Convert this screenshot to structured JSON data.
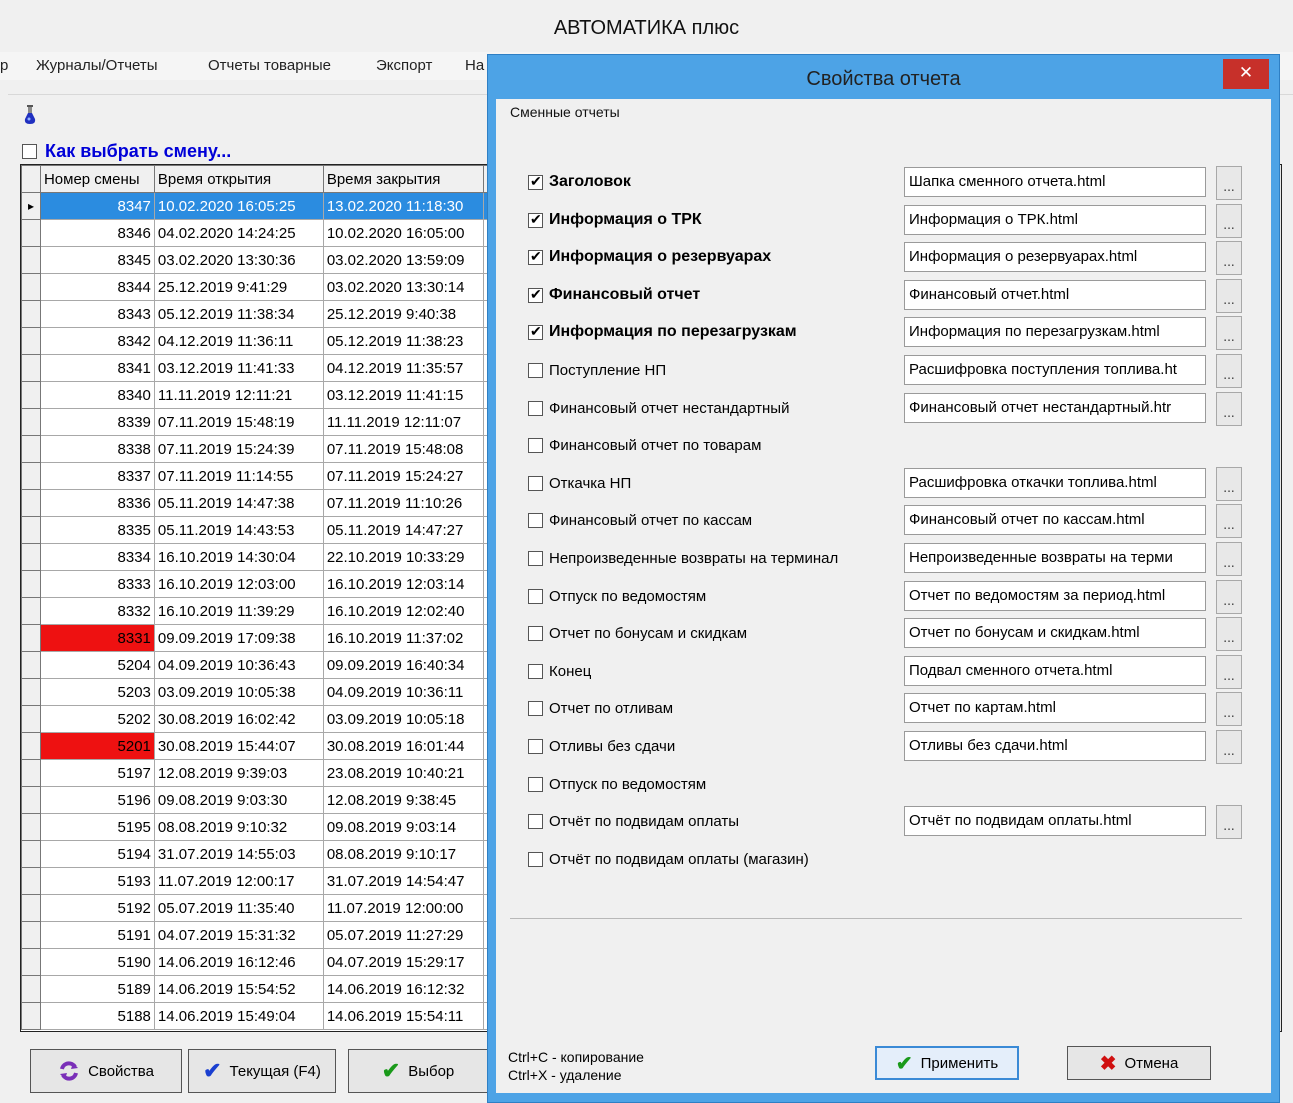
{
  "app": {
    "title": "АВТОМАТИКА плюс"
  },
  "menu": {
    "items": [
      {
        "label": "р"
      },
      {
        "label": "Журналы/Отчеты"
      },
      {
        "label": "Отчеты товарные"
      },
      {
        "label": "Экспорт"
      },
      {
        "label": "На"
      }
    ]
  },
  "shift_picker": {
    "link_label": "Как выбрать смену..."
  },
  "grid": {
    "columns": [
      "Номер смены",
      "Время открытия",
      "Время закрытия"
    ],
    "rows": [
      {
        "num": "8347",
        "open": "10.02.2020 16:05:25",
        "close": "13.02.2020 11:18:30"
      },
      {
        "num": "8346",
        "open": "04.02.2020 14:24:25",
        "close": "10.02.2020 16:05:00"
      },
      {
        "num": "8345",
        "open": "03.02.2020 13:30:36",
        "close": "03.02.2020 13:59:09"
      },
      {
        "num": "8344",
        "open": "25.12.2019 9:41:29",
        "close": "03.02.2020 13:30:14"
      },
      {
        "num": "8343",
        "open": "05.12.2019 11:38:34",
        "close": "25.12.2019 9:40:38"
      },
      {
        "num": "8342",
        "open": "04.12.2019 11:36:11",
        "close": "05.12.2019 11:38:23"
      },
      {
        "num": "8341",
        "open": "03.12.2019 11:41:33",
        "close": "04.12.2019 11:35:57"
      },
      {
        "num": "8340",
        "open": "11.11.2019 12:11:21",
        "close": "03.12.2019 11:41:15"
      },
      {
        "num": "8339",
        "open": "07.11.2019 15:48:19",
        "close": "11.11.2019 12:11:07"
      },
      {
        "num": "8338",
        "open": "07.11.2019 15:24:39",
        "close": "07.11.2019 15:48:08"
      },
      {
        "num": "8337",
        "open": "07.11.2019 11:14:55",
        "close": "07.11.2019 15:24:27"
      },
      {
        "num": "8336",
        "open": "05.11.2019 14:47:38",
        "close": "07.11.2019 11:10:26"
      },
      {
        "num": "8335",
        "open": "05.11.2019 14:43:53",
        "close": "05.11.2019 14:47:27"
      },
      {
        "num": "8334",
        "open": "16.10.2019 14:30:04",
        "close": "22.10.2019 10:33:29"
      },
      {
        "num": "8333",
        "open": "16.10.2019 12:03:00",
        "close": "16.10.2019 12:03:14"
      },
      {
        "num": "8332",
        "open": "16.10.2019 11:39:29",
        "close": "16.10.2019 12:02:40"
      },
      {
        "num": "8331",
        "open": "09.09.2019 17:09:38",
        "close": "16.10.2019 11:37:02"
      },
      {
        "num": "5204",
        "open": "04.09.2019 10:36:43",
        "close": "09.09.2019 16:40:34"
      },
      {
        "num": "5203",
        "open": "03.09.2019 10:05:38",
        "close": "04.09.2019 10:36:11"
      },
      {
        "num": "5202",
        "open": "30.08.2019 16:02:42",
        "close": "03.09.2019 10:05:18"
      },
      {
        "num": "5201",
        "open": "30.08.2019 15:44:07",
        "close": "30.08.2019 16:01:44"
      },
      {
        "num": "5197",
        "open": "12.08.2019 9:39:03",
        "close": "23.08.2019 10:40:21"
      },
      {
        "num": "5196",
        "open": "09.08.2019 9:03:30",
        "close": "12.08.2019 9:38:45"
      },
      {
        "num": "5195",
        "open": "08.08.2019 9:10:32",
        "close": "09.08.2019 9:03:14"
      },
      {
        "num": "5194",
        "open": "31.07.2019 14:55:03",
        "close": "08.08.2019 9:10:17"
      },
      {
        "num": "5193",
        "open": "11.07.2019 12:00:17",
        "close": "31.07.2019 14:54:47"
      },
      {
        "num": "5192",
        "open": "05.07.2019 11:35:40",
        "close": "11.07.2019 12:00:00"
      },
      {
        "num": "5191",
        "open": "04.07.2019 15:31:32",
        "close": "05.07.2019 11:27:29"
      },
      {
        "num": "5190",
        "open": "14.06.2019 16:12:46",
        "close": "04.07.2019 15:29:17"
      },
      {
        "num": "5189",
        "open": "14.06.2019 15:54:52",
        "close": "14.06.2019 16:12:32"
      },
      {
        "num": "5188",
        "open": "14.06.2019 15:49:04",
        "close": "14.06.2019 15:54:11"
      }
    ],
    "highlight_color": "#ee1111",
    "selection_color": "#2b8ce0"
  },
  "buttons": {
    "properties": "Свойства",
    "current": "Текущая (F4)",
    "select": "Выбор"
  },
  "dialog": {
    "title": "Свойства отчета",
    "close_icon": "close-icon",
    "group_title": "Сменные отчеты",
    "items": [
      {
        "label": "Заголовок",
        "checked": true,
        "bold": true,
        "file": "Шапка сменного отчета.html"
      },
      {
        "label": "Информация о ТРК",
        "checked": true,
        "bold": true,
        "file": "Информация о ТРК.html"
      },
      {
        "label": "Информация о резервуарах",
        "checked": true,
        "bold": true,
        "file": "Информация о резервуарах.html"
      },
      {
        "label": "Финансовый отчет",
        "checked": true,
        "bold": true,
        "file": "Финансовый отчет.html"
      },
      {
        "label": "Информация по перезагрузкам",
        "checked": true,
        "bold": true,
        "file": "Информация по перезагрузкам.html"
      },
      {
        "label": "Поступление НП",
        "checked": false,
        "bold": false,
        "file": "Расшифровка поступления топлива.ht"
      },
      {
        "label": "Финансовый отчет нестандартный",
        "checked": false,
        "bold": false,
        "file": "Финансовый отчет нестандартный.htr"
      },
      {
        "label": "Финансовый отчет по товарам",
        "checked": false,
        "bold": false,
        "file": null
      },
      {
        "label": "Откачка НП",
        "checked": false,
        "bold": false,
        "file": "Расшифровка откачки топлива.html"
      },
      {
        "label": "Финансовый отчет по кассам",
        "checked": false,
        "bold": false,
        "file": "Финансовый отчет по кассам.html"
      },
      {
        "label": "Непроизведенные возвраты на терминал",
        "checked": false,
        "bold": false,
        "file": "Непроизведенные возвраты на терми"
      },
      {
        "label": "Отпуск по ведомостям",
        "checked": false,
        "bold": false,
        "file": "Отчет по ведомостям за период.html"
      },
      {
        "label": "Отчет по бонусам и скидкам",
        "checked": false,
        "bold": false,
        "file": "Отчет по бонусам и скидкам.html"
      },
      {
        "label": "Конец",
        "checked": false,
        "bold": false,
        "file": "Подвал сменного отчета.html"
      },
      {
        "label": "Отчет по отливам",
        "checked": false,
        "bold": false,
        "file": "Отчет по картам.html"
      },
      {
        "label": "Отливы без сдачи",
        "checked": false,
        "bold": false,
        "file": "Отливы без сдачи.html"
      },
      {
        "label": "Отпуск по ведомостям",
        "checked": false,
        "bold": false,
        "file": null
      },
      {
        "label": "Отчёт по подвидам оплаты",
        "checked": false,
        "bold": false,
        "file": "Отчёт по подвидам оплаты.html"
      },
      {
        "label": "Отчёт по подвидам оплаты (магазин)",
        "checked": false,
        "bold": false,
        "file": null
      }
    ],
    "browse_label": "...",
    "hint_copy": "Ctrl+C - копирование",
    "hint_delete": "Ctrl+X - удаление",
    "apply": "Применить",
    "cancel": "Отмена",
    "accent": "#4da3e6"
  }
}
